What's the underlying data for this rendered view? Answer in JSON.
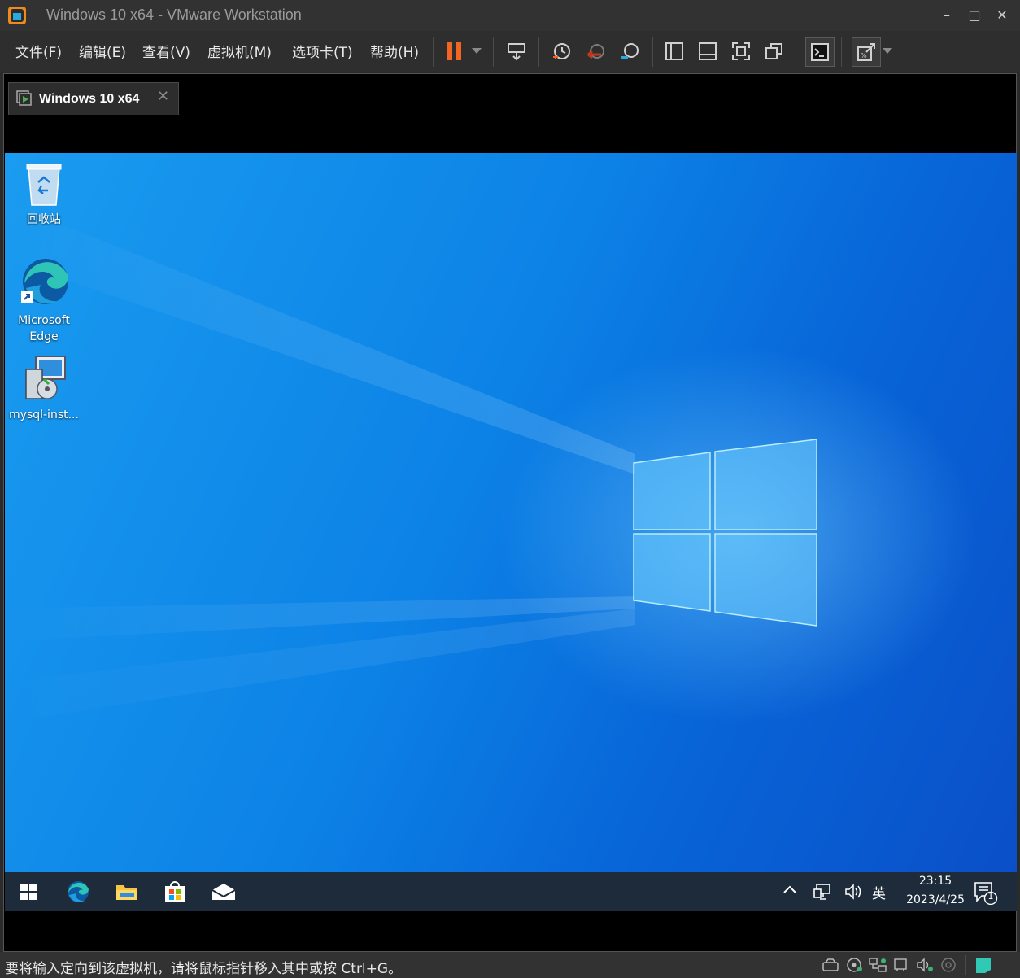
{
  "window": {
    "title": "Windows 10 x64 - VMware Workstation"
  },
  "menu": {
    "items": [
      "文件(F)",
      "编辑(E)",
      "查看(V)",
      "虚拟机(M)",
      "选项卡(T)",
      "帮助(H)"
    ]
  },
  "vm_tab": {
    "label": "Windows 10 x64"
  },
  "desktop": {
    "icons": [
      {
        "label": "回收站",
        "icon": "recycle-bin-icon"
      },
      {
        "label_line1": "Microsoft",
        "label_line2": "Edge",
        "icon": "edge-icon"
      },
      {
        "label": "mysql-inst...",
        "icon": "installer-icon"
      }
    ]
  },
  "taskbar": {
    "ime": "英",
    "time": "23:15",
    "date": "2023/4/25",
    "notification_count": "1"
  },
  "statusbar": {
    "message": "要将输入定向到该虚拟机，请将鼠标指针移入其中或按 Ctrl+G。"
  },
  "colors": {
    "accent_pause": "#f26522",
    "desktop_blue": "#0c82e6",
    "taskbar": "#1d2b3a"
  }
}
